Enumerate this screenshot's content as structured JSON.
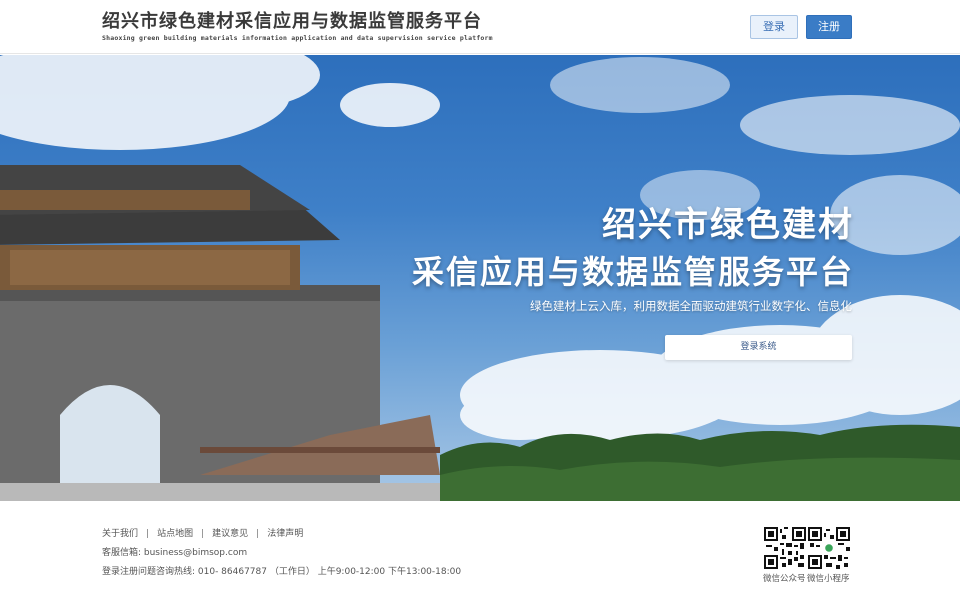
{
  "header": {
    "logo_title": "绍兴市绿色建材采信应用与数据监管服务平台",
    "logo_subtitle": "Shaoxing green building materials information application and data supervision service platform",
    "login_label": "登录",
    "register_label": "注册"
  },
  "hero": {
    "title_line1": "绍兴市绿色建材",
    "title_line2": "采信应用与数据监管服务平台",
    "subtitle": "绿色建材上云入库，利用数据全面驱动建筑行业数字化、信息化",
    "login_system_label": "登录系统"
  },
  "footer": {
    "links": [
      {
        "label": "关于我们"
      },
      {
        "label": "站点地图"
      },
      {
        "label": "建议意见"
      },
      {
        "label": "法律声明"
      }
    ],
    "separator": "|",
    "email": "客服信箱:  business@bimsop.com",
    "phone": "登录注册问题咨询热线:  010- 86467787  （工作日）  上午9:00-12:00 下午13:00-18:00",
    "qr_official_label": "微信公众号",
    "qr_miniprogram_label": "微信小程序"
  }
}
